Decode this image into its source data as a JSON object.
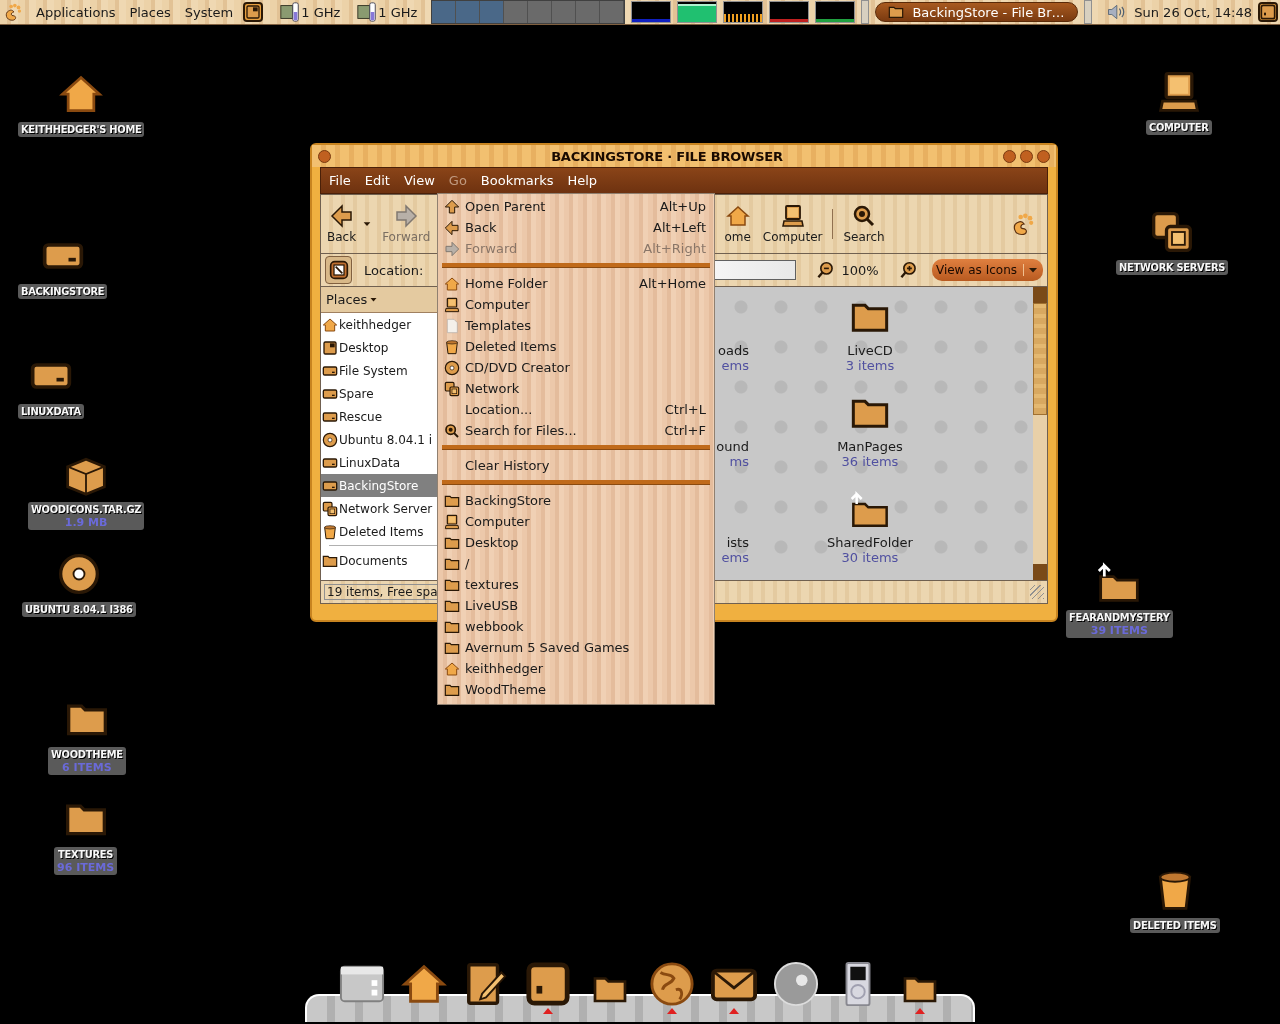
{
  "top_panel": {
    "menus": [
      "Applications",
      "Places",
      "System"
    ],
    "cpu_freqs": [
      "1 GHz",
      "1 GHz"
    ],
    "taskbar": [
      {
        "label": "BackingStore - File Br…",
        "selected": true
      }
    ],
    "clock": "Sun 26 Oct, 14:48"
  },
  "desktop_icons": [
    {
      "kind": "home",
      "label": "KEITHHEDGER'S HOME"
    },
    {
      "kind": "drive",
      "label": "BACKINGSTORE"
    },
    {
      "kind": "drive",
      "label": "LINUXDATA"
    },
    {
      "kind": "package",
      "label": "WOODICONS.TAR.GZ",
      "detail": "1.9 MB"
    },
    {
      "kind": "disc",
      "label": "UBUNTU 8.04.1 I386"
    },
    {
      "kind": "folder",
      "label": "WOODTHEME",
      "detail": "6 ITEMS"
    },
    {
      "kind": "folder",
      "label": "TEXTURES",
      "detail": "96 ITEMS"
    },
    {
      "kind": "computer",
      "label": "COMPUTER"
    },
    {
      "kind": "network",
      "label": "NETWORK SERVERS"
    },
    {
      "kind": "folderlink",
      "label": "FEARANDMYSTERY",
      "detail": "39 ITEMS"
    },
    {
      "kind": "trash",
      "label": "DELETED ITEMS"
    }
  ],
  "window": {
    "title": "BACKINGSTORE · FILE BROWSER",
    "menu": [
      {
        "label": "File",
        "selected": false
      },
      {
        "label": "Edit",
        "selected": false
      },
      {
        "label": "View",
        "selected": false
      },
      {
        "label": "Go",
        "selected": true
      },
      {
        "label": "Bookmarks",
        "selected": false
      },
      {
        "label": "Help",
        "selected": false
      }
    ],
    "toolbar": [
      {
        "kind": "left",
        "label": "Back",
        "disabled": false
      },
      {
        "kind": "right",
        "label": "Forward",
        "disabled": true
      },
      {
        "kind": "home",
        "label": "ome",
        "disabled": false
      },
      {
        "kind": "computer",
        "label": "Computer",
        "disabled": false
      },
      {
        "kind": "search",
        "label": "Search",
        "disabled": false
      }
    ],
    "location_label": "Location:",
    "zoom": "100%",
    "view_mode": "View as Icons",
    "sidebar": {
      "header": "Places",
      "items": [
        {
          "kind": "home",
          "label": "keithhedger",
          "selected": false
        },
        {
          "kind": "desktop",
          "label": "Desktop",
          "selected": false
        },
        {
          "kind": "drive",
          "label": "File System",
          "selected": false
        },
        {
          "kind": "drive",
          "label": "Spare",
          "selected": false
        },
        {
          "kind": "drive",
          "label": "Rescue",
          "selected": false
        },
        {
          "kind": "disc",
          "label": "Ubuntu 8.04.1 i",
          "selected": false
        },
        {
          "kind": "drive",
          "label": "LinuxData",
          "selected": false
        },
        {
          "kind": "drive",
          "label": "BackingStore",
          "selected": true
        },
        {
          "kind": "network",
          "label": "Network Server",
          "selected": false
        },
        {
          "kind": "trash",
          "label": "Deleted Items",
          "selected": false
        }
      ],
      "bookmarks": [
        {
          "kind": "folder",
          "label": "Documents",
          "selected": false
        }
      ]
    },
    "files": [
      {
        "name": "oads",
        "detail": "ems"
      },
      {
        "name": "LiveCD",
        "detail": "3 items"
      },
      {
        "name": "ound",
        "detail": "ms"
      },
      {
        "name": "ManPages",
        "detail": "36 items"
      },
      {
        "name": "ists",
        "detail": "ems"
      },
      {
        "name": "SharedFolder",
        "detail": "30 items"
      }
    ],
    "status": "19 items, Free spa"
  },
  "go_menu": [
    {
      "kind": "up",
      "label": "Open Parent",
      "shortcut": "Alt+Up",
      "disabled": false
    },
    {
      "kind": "left",
      "label": "Back",
      "shortcut": "Alt+Left",
      "disabled": false
    },
    {
      "kind": "right",
      "label": "Forward",
      "shortcut": "Alt+Right",
      "disabled": true
    },
    {
      "kind": "separator"
    },
    {
      "kind": "home",
      "label": "Home Folder",
      "shortcut": "Alt+Home",
      "disabled": false
    },
    {
      "kind": "computer",
      "label": "Computer",
      "disabled": false
    },
    {
      "kind": "doc",
      "label": "Templates",
      "disabled": false
    },
    {
      "kind": "trash",
      "label": "Deleted Items",
      "disabled": false
    },
    {
      "kind": "disc",
      "label": "CD/DVD Creator",
      "disabled": false
    },
    {
      "kind": "network",
      "label": "Network",
      "disabled": false
    },
    {
      "kind": "plain",
      "label": "Location...",
      "shortcut": "Ctrl+L",
      "disabled": false
    },
    {
      "kind": "search",
      "label": "Search for Files...",
      "shortcut": "Ctrl+F",
      "disabled": false
    },
    {
      "kind": "separator"
    },
    {
      "kind": "plain",
      "label": "Clear History",
      "disabled": false
    },
    {
      "kind": "separator"
    },
    {
      "kind": "folder",
      "label": "BackingStore",
      "disabled": false
    },
    {
      "kind": "computer",
      "label": "Computer",
      "disabled": false
    },
    {
      "kind": "folder",
      "label": "Desktop",
      "disabled": false
    },
    {
      "kind": "folder",
      "label": "/",
      "disabled": false
    },
    {
      "kind": "folder",
      "label": "textures",
      "disabled": false
    },
    {
      "kind": "folder",
      "label": "LiveUSB",
      "disabled": false
    },
    {
      "kind": "folder",
      "label": "webbook",
      "disabled": false
    },
    {
      "kind": "folder",
      "label": "Avernum 5 Saved Games",
      "disabled": false
    },
    {
      "kind": "home",
      "label": "keithhedger",
      "disabled": false
    },
    {
      "kind": "folder",
      "label": "WoodTheme",
      "disabled": false
    }
  ],
  "dock": [
    {
      "kind": "window",
      "running": false
    },
    {
      "kind": "home",
      "running": false
    },
    {
      "kind": "editor",
      "running": false
    },
    {
      "kind": "terminal",
      "running": true
    },
    {
      "kind": "folder",
      "running": false
    },
    {
      "kind": "globe",
      "running": true
    },
    {
      "kind": "mail",
      "running": true
    },
    {
      "kind": "sphere",
      "running": false
    },
    {
      "kind": "player",
      "running": false
    },
    {
      "kind": "folder",
      "running": true
    }
  ]
}
